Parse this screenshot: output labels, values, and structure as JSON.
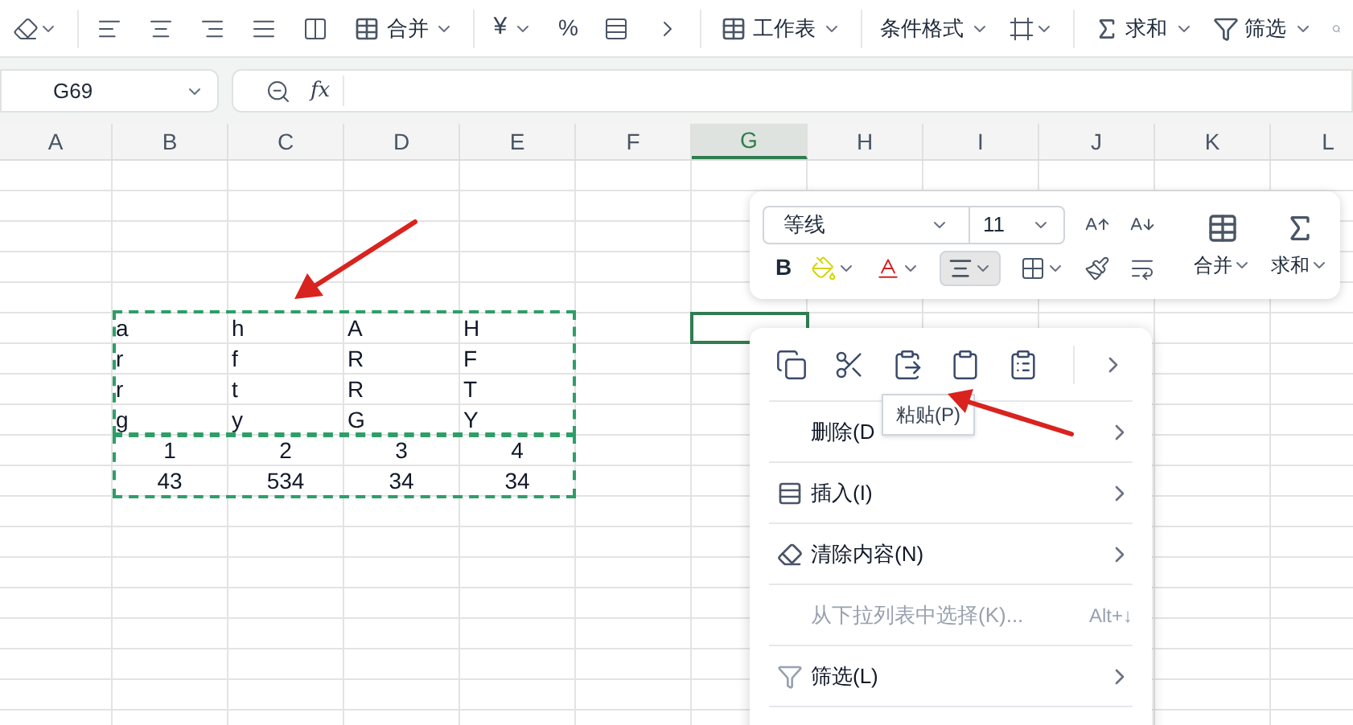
{
  "toolbar": {
    "merge": "合并",
    "currency": "¥",
    "percent": "%",
    "worksheet": "工作表",
    "conditional_format": "条件格式",
    "sum": "求和",
    "filter": "筛选"
  },
  "name_box": {
    "value": "G69"
  },
  "formula_bar": {
    "fx": "fx"
  },
  "sheet": {
    "columns": [
      {
        "label": "A",
        "selected": false
      },
      {
        "label": "B",
        "selected": false
      },
      {
        "label": "C",
        "selected": false
      },
      {
        "label": "D",
        "selected": false
      },
      {
        "label": "E",
        "selected": false
      },
      {
        "label": "F",
        "selected": false
      },
      {
        "label": "G",
        "selected": true
      },
      {
        "label": "H",
        "selected": false
      },
      {
        "label": "I",
        "selected": false
      },
      {
        "label": "J",
        "selected": false
      },
      {
        "label": "K",
        "selected": false
      },
      {
        "label": "L",
        "selected": false
      }
    ],
    "rows": [
      {
        "kind": "text",
        "cells": [
          "a",
          "h",
          "A",
          "H"
        ]
      },
      {
        "kind": "text",
        "cells": [
          "r",
          "f",
          "R",
          "F"
        ]
      },
      {
        "kind": "text",
        "cells": [
          "r",
          "t",
          "R",
          "T"
        ]
      },
      {
        "kind": "text",
        "cells": [
          "g",
          "y",
          "G",
          "Y"
        ]
      },
      {
        "kind": "number",
        "cells": [
          "1",
          "2",
          "3",
          "4"
        ]
      },
      {
        "kind": "number",
        "cells": [
          "43",
          "534",
          "34",
          "34"
        ]
      }
    ]
  },
  "mini_toolbar": {
    "font": "等线",
    "size": "11",
    "bold": "B",
    "center_selected": true,
    "merge": "合并",
    "sum": "求和"
  },
  "context_menu": {
    "tooltip": "粘贴(P)",
    "items": [
      {
        "label": "删除(D",
        "submenu": true
      },
      {
        "label": "插入(I)",
        "submenu": true
      },
      {
        "label": "清除内容(N)",
        "submenu": true
      },
      {
        "label": "从下拉列表中选择(K)...",
        "submenu": false,
        "shortcut": "Alt+↓"
      },
      {
        "label": "筛选(L)",
        "submenu": true
      }
    ]
  }
}
